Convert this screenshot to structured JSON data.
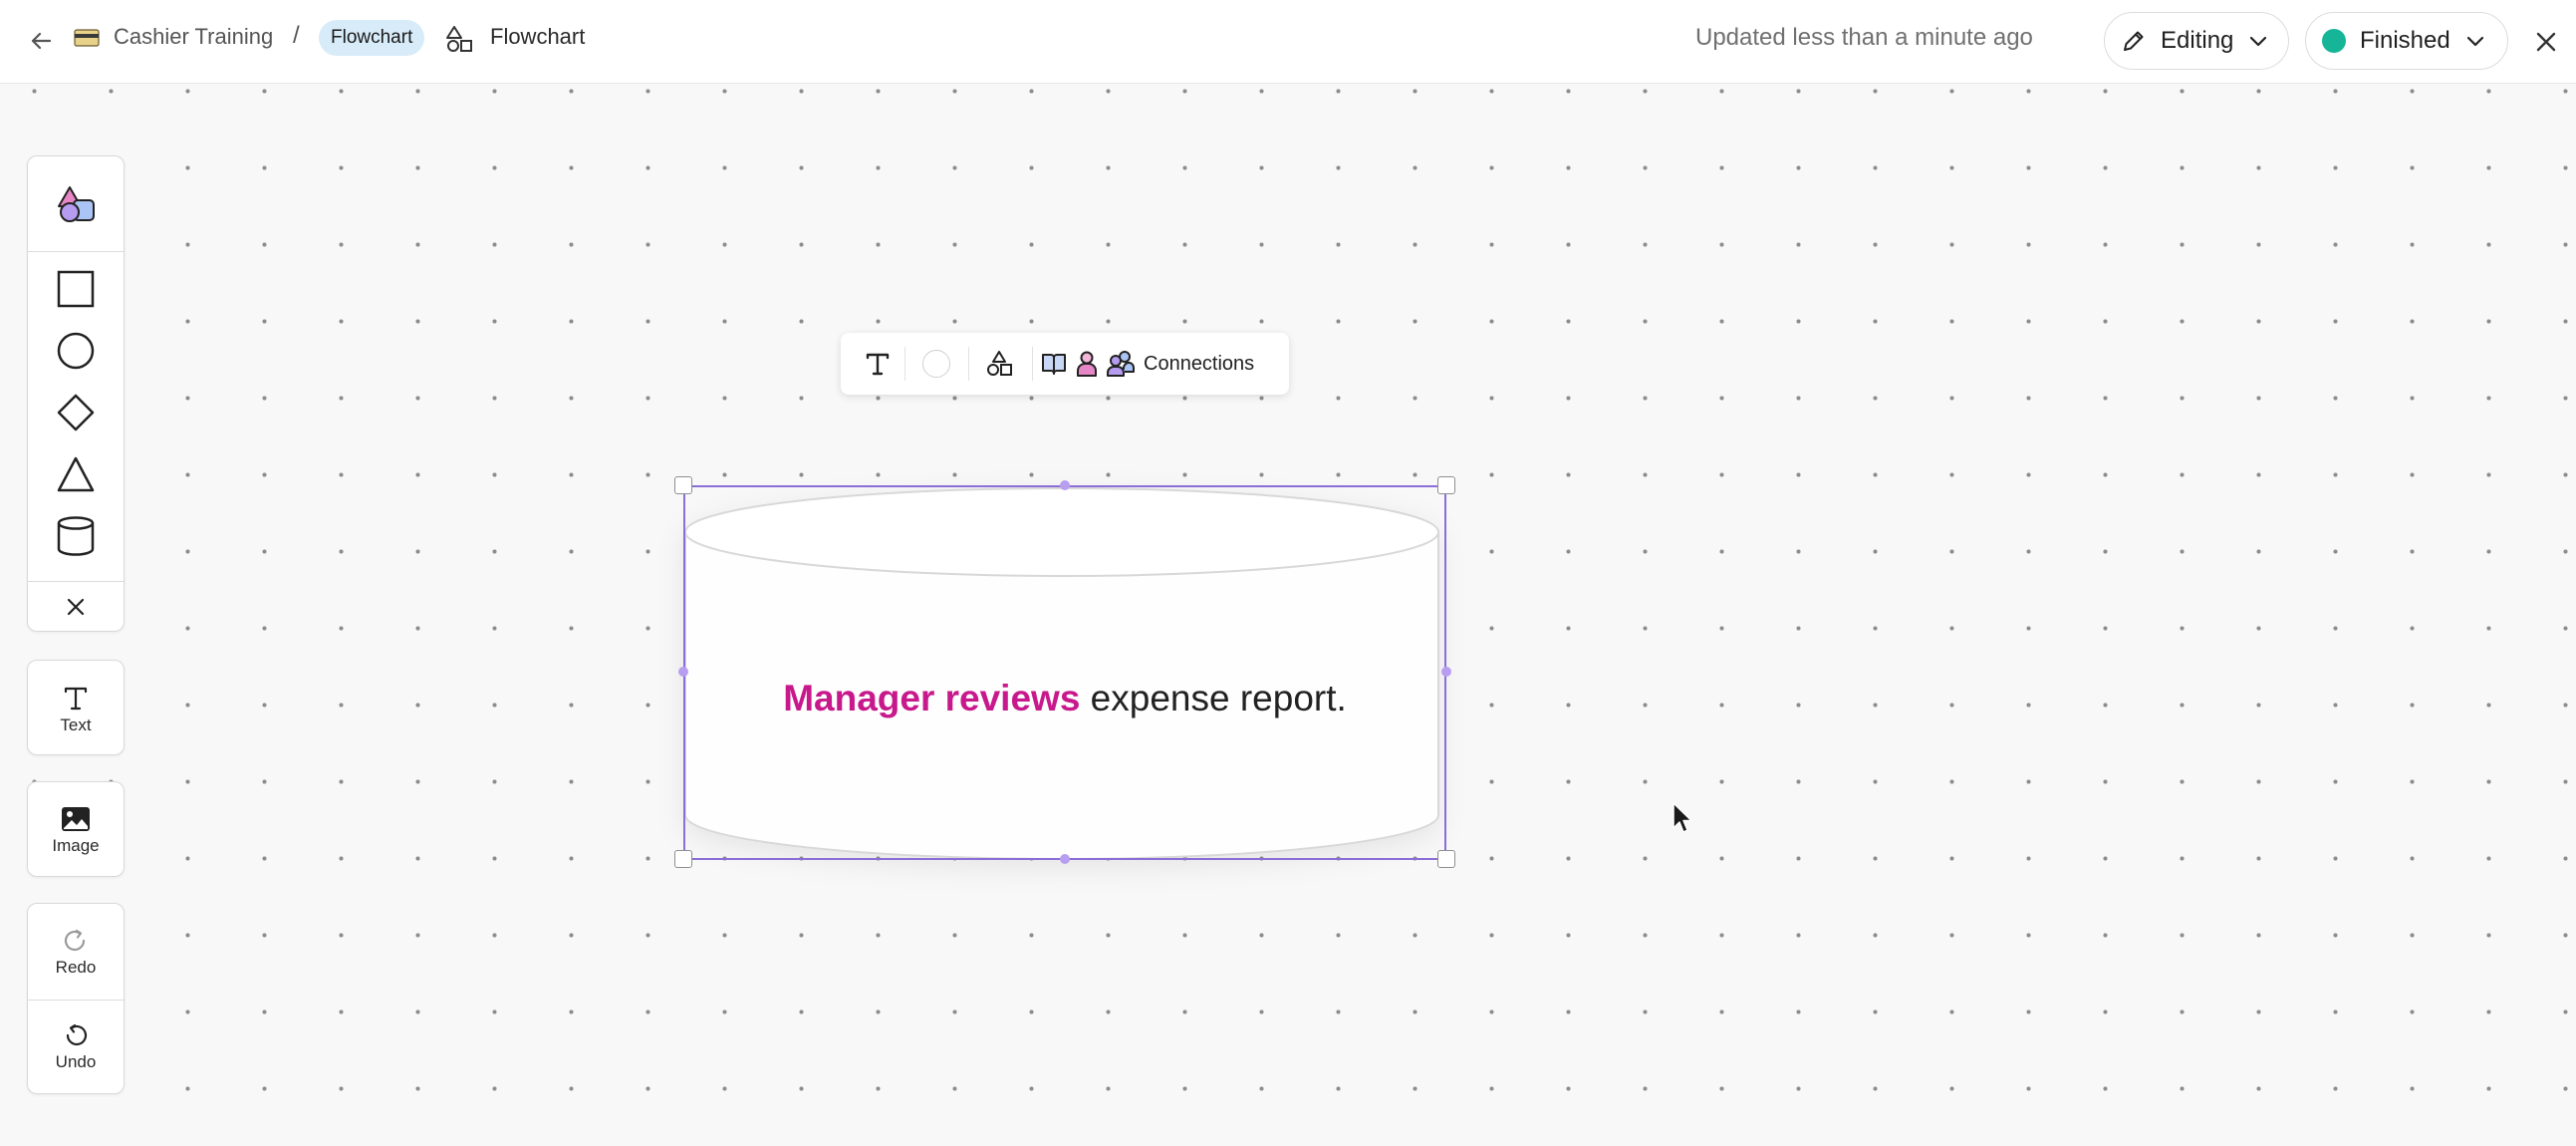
{
  "header": {
    "breadcrumb_parent": "Cashier Training",
    "breadcrumb_separator": "/",
    "breadcrumb_pill": "Flowchart",
    "breadcrumb_current": "Flowchart",
    "updated_text": "Updated less than a minute ago",
    "mode_label": "Editing",
    "status_label": "Finished",
    "status_color": "#16b597"
  },
  "palette": {
    "shapes": [
      "shapes-icon",
      "square-icon",
      "circle-icon",
      "diamond-icon",
      "triangle-icon",
      "cylinder-icon",
      "close-icon"
    ],
    "text_label": "Text",
    "image_label": "Image",
    "redo_label": "Redo",
    "undo_label": "Undo"
  },
  "float_toolbar": {
    "connections_label": "Connections"
  },
  "shape": {
    "type": "cylinder",
    "text_highlight": "Manager reviews",
    "text_rest": " expense report.",
    "highlight_color": "#c8198c",
    "selection_color": "#8b6fd6"
  }
}
